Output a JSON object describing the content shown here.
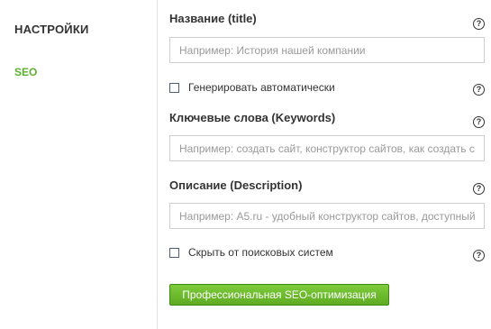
{
  "sidebar": {
    "title": "НАСТРОЙКИ",
    "active_item": "SEO",
    "active_color": "#5cb030"
  },
  "form": {
    "title_label": "Название (title)",
    "title_placeholder": "Например: История нашей компании",
    "generate_label": "Генерировать автоматически",
    "generate_checked": false,
    "keywords_label": "Ключевые слова (Keywords)",
    "keywords_placeholder": "Например: создать сайт, конструктор сайтов, как создать сайт",
    "description_label": "Описание (Description)",
    "description_placeholder": "Например: A5.ru - удобный конструктор сайтов, доступный каждому",
    "hide_label": "Скрыть от поисковых систем",
    "hide_checked": false,
    "help_glyph": "?",
    "pro_button_label": "Профессиональная SEO-оптимизация"
  },
  "colors": {
    "button_green": "#6abb2c",
    "checkbox_border": "#4a5e74"
  },
  "icons": [
    "help-icon"
  ]
}
